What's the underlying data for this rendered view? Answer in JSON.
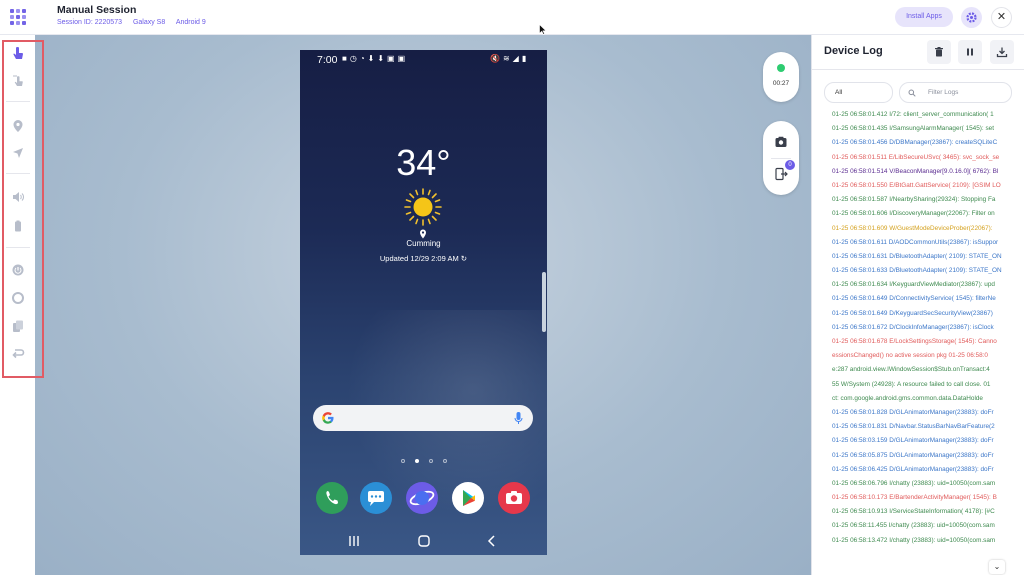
{
  "header": {
    "title": "Manual Session",
    "session_id": "Session ID: 2220573",
    "device": "Galaxy S8",
    "os": "Android 9",
    "install_apps": "Install Apps"
  },
  "toolbar": {
    "tools": [
      "tap-icon",
      "swipe-icon",
      "location-icon",
      "gps-icon",
      "volume-icon",
      "battery-icon",
      "power-icon",
      "home-icon",
      "recent-apps-icon",
      "back-icon"
    ]
  },
  "phone": {
    "status_time": "7:00",
    "temperature": "34°",
    "city": "Cumming",
    "updated": "Updated 12/29 2:09 AM",
    "apps": [
      "phone-app-icon",
      "messages-app-icon",
      "internet-app-icon",
      "play-store-app-icon",
      "camera-app-icon"
    ]
  },
  "recording": {
    "timer": "00:27",
    "status_color": "#2ecc71"
  },
  "capture": {
    "badge": "0"
  },
  "device_log": {
    "title": "Device Log",
    "filter_selected": "All",
    "filter_placeholder": "Filter Logs",
    "lines": [
      {
        "text": "01-25 06:58:01.412 I/72: client_server_communication( 1",
        "color": "#3e8a4f"
      },
      {
        "text": "01-25 06:58:01.435 I/SamsungAlarmManager( 1545): set",
        "color": "#3e8a4f"
      },
      {
        "text": "01-25 06:58:01.456 D/DBManager(23867): createSQLiteC",
        "color": "#3b76c8"
      },
      {
        "text": "01-25 06:58:01.511 E/LibSecureUSvc( 3465): svc_sock_se",
        "color": "#e05a5a"
      },
      {
        "text": "01-25 06:58:01.514 V/BeaconManager[9.0.16.0]( 6762): Bl",
        "color": "#5b2d91"
      },
      {
        "text": "01-25 06:58:01.550 E/BtGatt.GattService( 2109): [GSIM LO",
        "color": "#e05a5a"
      },
      {
        "text": "01-25 06:58:01.587 I/NearbySharing(29324): Stopping Fa",
        "color": "#3e8a4f"
      },
      {
        "text": "01-25 06:58:01.606 I/DiscoveryManager(22067): Filter on",
        "color": "#3e8a4f"
      },
      {
        "text": "01-25 06:58:01.609 W/GuestModeDeviceProber(22067):",
        "color": "#d4a11e"
      },
      {
        "text": "01-25 06:58:01.611 D/AODCommonUtils(23867): isSuppor",
        "color": "#3b76c8"
      },
      {
        "text": "01-25 06:58:01.631 D/BluetoothAdapter( 2109): STATE_ON",
        "color": "#3b76c8"
      },
      {
        "text": "01-25 06:58:01.633 D/BluetoothAdapter( 2109): STATE_ON",
        "color": "#3b76c8"
      },
      {
        "text": "01-25 06:58:01.634 I/KeyguardViewMediator(23867): upd",
        "color": "#3e8a4f"
      },
      {
        "text": "01-25 06:58:01.649 D/ConnectivityService( 1545): filterNe",
        "color": "#3b76c8"
      },
      {
        "text": "01-25 06:58:01.649 D/KeyguardSecSecurityView(23867)",
        "color": "#3b76c8"
      },
      {
        "text": "01-25 06:58:01.672 D/ClockInfoManager(23867): isClock",
        "color": "#3b76c8"
      },
      {
        "text": "01-25 06:58:01.678 E/LockSettingsStorage( 1545): Canno",
        "color": "#e05a5a"
      },
      {
        "text": "essionsChanged() no active session pkg 01-25 06:58:0",
        "color": "#e05a5a"
      },
      {
        "text": "e:287 android.view.IWindowSession$Stub.onTransact:4",
        "color": "#3e8a4f"
      },
      {
        "text": "55 W/System (24928): A resource failed to call close. 01",
        "color": "#3e8a4f"
      },
      {
        "text": "ct: com.google.android.gms.common.data.DataHolde",
        "color": "#3e8a4f"
      },
      {
        "text": "01-25 06:58:01.828 D/GLAnimatorManager(23883): doFr",
        "color": "#3b76c8"
      },
      {
        "text": "01-25 06:58:01.831 D/Navbar.StatusBarNavBarFeature(2",
        "color": "#3b76c8"
      },
      {
        "text": "01-25 06:58:03.159 D/GLAnimatorManager(23883): doFr",
        "color": "#3b76c8"
      },
      {
        "text": "01-25 06:58:05.875 D/GLAnimatorManager(23883): doFr",
        "color": "#3b76c8"
      },
      {
        "text": "01-25 06:58:06.425 D/GLAnimatorManager(23883): doFr",
        "color": "#3b76c8"
      },
      {
        "text": "01-25 06:58:06.796 I/chatty (23883): uid=10050(com.sam",
        "color": "#3e8a4f"
      },
      {
        "text": "01-25 06:58:10.173 E/BartenderActivityManager( 1545): B",
        "color": "#e05a5a"
      },
      {
        "text": "01-25 06:58:10.913 I/ServiceStateInformation( 4178): [#C",
        "color": "#3e8a4f"
      },
      {
        "text": "01-25 06:58:11.455 I/chatty (23883): uid=10050(com.sam",
        "color": "#3e8a4f"
      },
      {
        "text": "01-25 06:58:13.472 I/chatty (23883): uid=10050(com.sam",
        "color": "#3e8a4f"
      }
    ]
  },
  "colors": {
    "accent": "#6c5ce7",
    "highlight": "#e15b64"
  }
}
